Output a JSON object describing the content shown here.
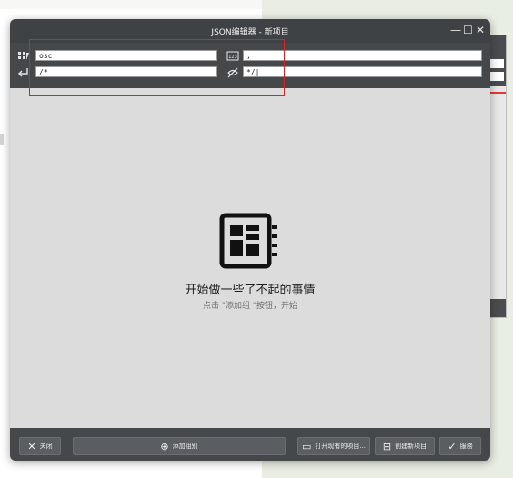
{
  "window": {
    "title": "JSON编辑器 - 新项目"
  },
  "settings": {
    "field1": "osc",
    "field2": ",",
    "field3": "/*",
    "field4": "*/|"
  },
  "empty_state": {
    "title": "开始做一些了不起的事情",
    "subtitle": "点击 \"添加组 \"按钮，开始"
  },
  "buttons": {
    "close": "关闭",
    "add_group": "添加组别",
    "open_existing": "打开现有的项目...",
    "create_new": "创建新项目",
    "save": "服務"
  }
}
